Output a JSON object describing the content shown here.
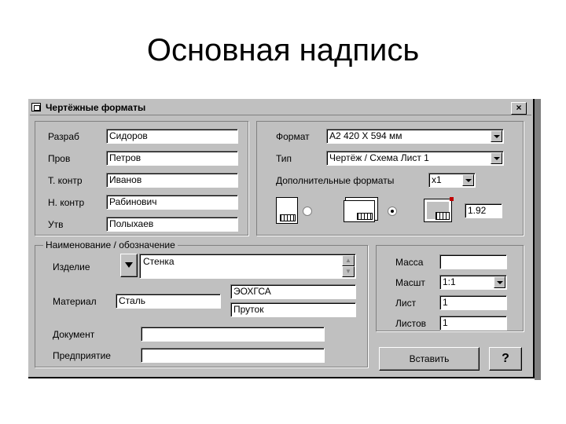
{
  "slide": {
    "title": "Основная надпись"
  },
  "window": {
    "title": "Чертёжные форматы",
    "close_label": "×",
    "icon": "window-icon"
  },
  "signatures": [
    {
      "label": "Разраб",
      "value": "Сидоров"
    },
    {
      "label": "Пров",
      "value": "Петров"
    },
    {
      "label": "Т. контр",
      "value": "Иванов"
    },
    {
      "label": "Н. контр",
      "value": "Рабинович"
    },
    {
      "label": "Утв",
      "value": "Полыхаев"
    }
  ],
  "format": {
    "format_label": "Формат",
    "format_value": "А2 420 Х 594 мм",
    "type_label": "Тип",
    "type_value": "Чертёж / Схема Лист 1",
    "extra_label": "Дополнительные форматы",
    "extra_value": "x1",
    "scale_value": "1.92",
    "layout_icons": [
      "sheet-with-stamp-icon",
      "sheet-landscape-icon",
      "sheet-highlighted-icon"
    ],
    "selected_layout": 1
  },
  "naming": {
    "caption": "Наименование / обозначение",
    "product_label": "Изделие",
    "product_value": "Стенка",
    "material_label": "Материал",
    "material_value": "Сталь",
    "code1": "ЭОХГСА",
    "code2": "Пруток",
    "document_label": "Документ",
    "document_value": "",
    "enterprise_label": "Предприятие",
    "enterprise_value": ""
  },
  "props": {
    "mass_label": "Масса",
    "mass_value": "",
    "scale_label": "Масшт",
    "scale_value": "1:1",
    "sheet_label": "Лист",
    "sheet_value": "1",
    "sheets_label": "Листов",
    "sheets_value": "1"
  },
  "buttons": {
    "insert": "Вставить",
    "help": "?"
  }
}
